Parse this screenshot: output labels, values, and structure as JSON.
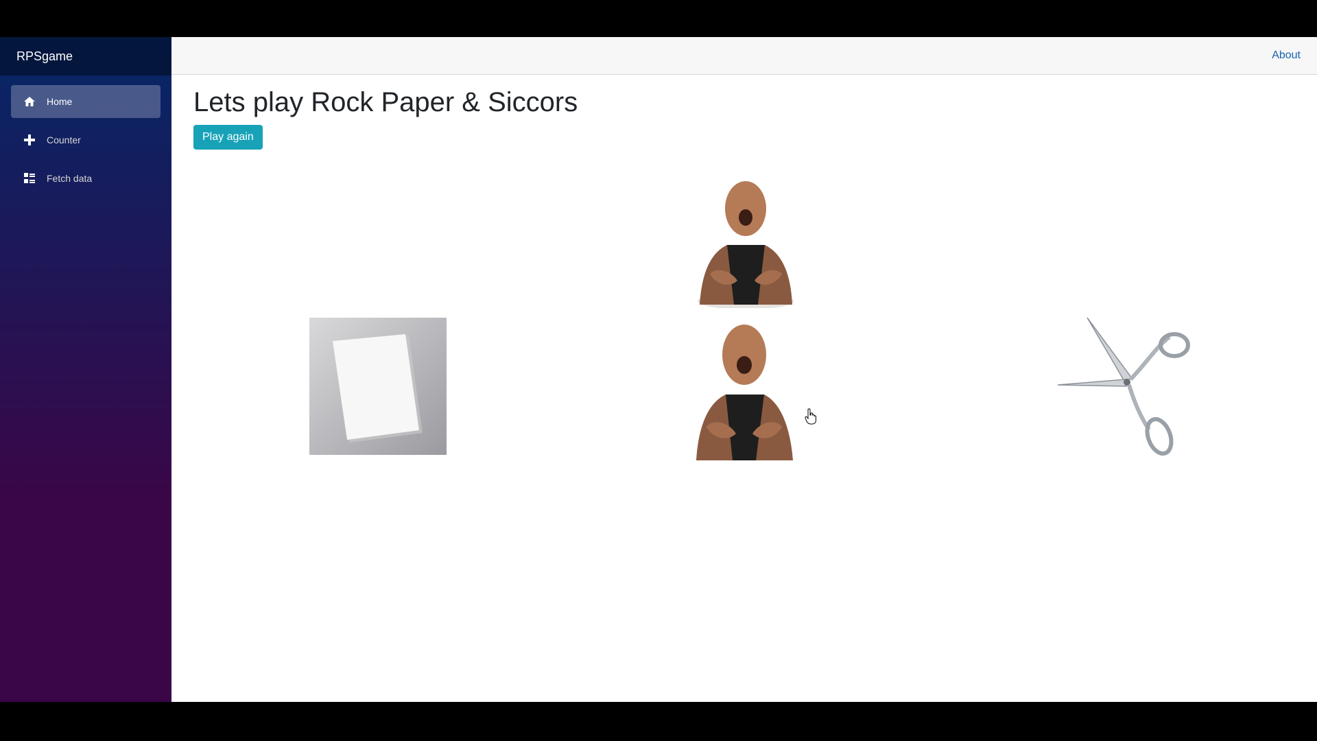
{
  "app": {
    "brand": "RPSgame"
  },
  "sidebar": {
    "items": [
      {
        "label": "Home",
        "icon": "home-icon",
        "active": true
      },
      {
        "label": "Counter",
        "icon": "plus-icon",
        "active": false
      },
      {
        "label": "Fetch data",
        "icon": "list-rich-icon",
        "active": false
      }
    ]
  },
  "header": {
    "about_label": "About"
  },
  "main": {
    "title": "Lets play Rock Paper & Siccors",
    "play_again_label": "Play again"
  },
  "game": {
    "computer_choice": "rock",
    "choices": [
      "paper",
      "rock",
      "scissors"
    ]
  },
  "colors": {
    "sidebar_top": "#052767",
    "sidebar_bottom": "#3a0647",
    "button": "#17a2b8",
    "link": "#1861ac"
  }
}
